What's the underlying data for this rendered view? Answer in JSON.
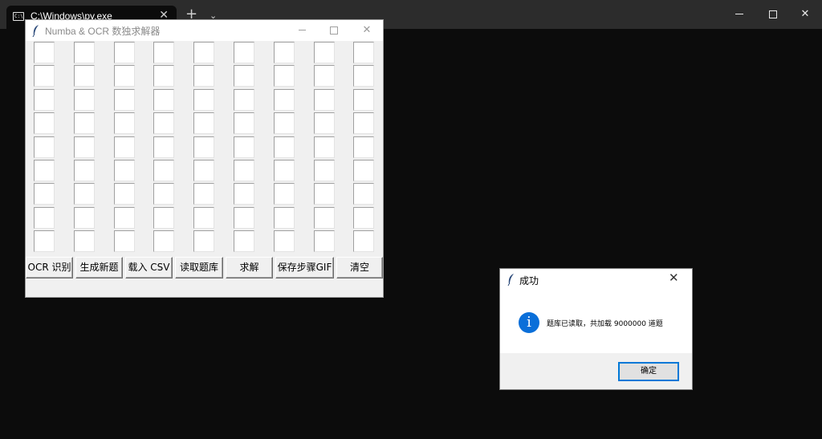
{
  "terminal": {
    "tab_title": "C:\\Windows\\py.exe",
    "tab_icon_text": "C:\\",
    "close_glyph": "✕",
    "new_tab_glyph": "+",
    "dropdown_glyph": "⌄"
  },
  "app": {
    "title": "Numba & OCR 数独求解器",
    "grid": {
      "rows": 9,
      "cols": 9
    },
    "buttons": [
      {
        "id": "ocr",
        "label": "OCR 识别"
      },
      {
        "id": "generate",
        "label": "生成新题"
      },
      {
        "id": "load-csv",
        "label": "载入 CSV"
      },
      {
        "id": "read-bank",
        "label": "读取题库"
      },
      {
        "id": "solve",
        "label": "求解"
      },
      {
        "id": "save-gif",
        "label": "保存步骤GIF"
      },
      {
        "id": "clear",
        "label": "清空"
      }
    ],
    "close_glyph": "✕"
  },
  "dialog": {
    "title": "成功",
    "message": "题库已读取，共加载 9000000 道题",
    "ok_label": "确定",
    "info_glyph": "i",
    "close_glyph": "✕"
  },
  "colors": {
    "accent": "#0078d7",
    "info_icon": "#0a6fd9",
    "terminal_bg": "#0c0c0c",
    "window_bg": "#f0f0f0"
  }
}
